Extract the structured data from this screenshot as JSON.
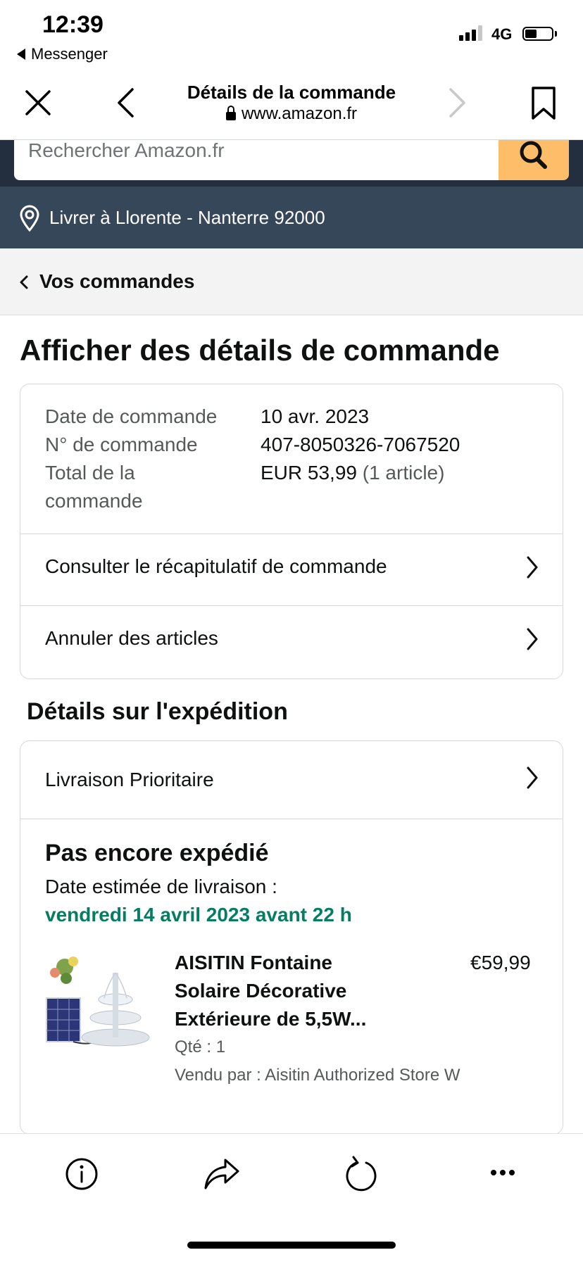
{
  "status_bar": {
    "time": "12:39",
    "back_app": "Messenger",
    "network": "4G"
  },
  "browser": {
    "title": "Détails de la commande",
    "url": "www.amazon.fr",
    "icons": [
      "close-icon",
      "back-chevron-icon",
      "forward-chevron-icon",
      "bookmark-icon"
    ]
  },
  "header": {
    "search_placeholder": "Rechercher Amazon.fr",
    "deliver_to": "Livrer à Llorente - Nanterre 92000",
    "colors": {
      "dark": "#232f3e",
      "secondary": "#37475a",
      "search_button": "#febd69"
    }
  },
  "breadcrumb": {
    "label": "Vos commandes"
  },
  "page_title": "Afficher des détails de commande",
  "order_summary": {
    "date_label": "Date de commande",
    "date_value": "10 avr. 2023",
    "number_label": "N° de commande",
    "number_value": "407-8050326-7067520",
    "total_label_line1": "Total de la",
    "total_label_line2": "commande",
    "total_value": "EUR 53,99",
    "total_count": "(1 article)",
    "link_recap": "Consulter le récapitulatif de commande",
    "link_cancel": "Annuler des articles"
  },
  "shipping": {
    "section_title": "Détails sur l'expédition",
    "method": "Livraison Prioritaire",
    "status": "Pas encore expédié",
    "estimate_label": "Date estimée de livraison :",
    "estimate_date": "vendredi 14 avril 2023 avant 22 h",
    "estimate_color": "#067d62"
  },
  "product": {
    "title_line1": "AISITIN Fontaine",
    "title_line2": "Solaire Décorative",
    "title_line3": "Extérieure de 5,5W...",
    "price": "€59,99",
    "qty": "Qté : 1",
    "seller": "Vendu par : Aisitin Authorized Store W"
  },
  "toolbar": {
    "icons": [
      "info-icon",
      "share-icon",
      "reload-icon",
      "more-icon"
    ]
  }
}
